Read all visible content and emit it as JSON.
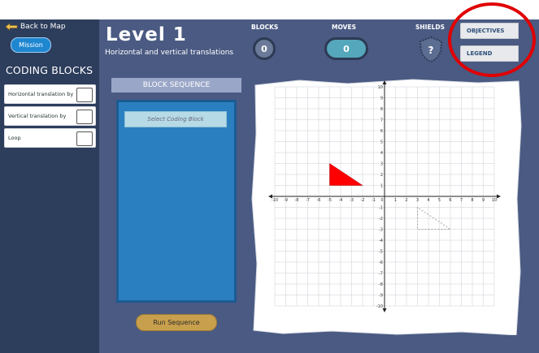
{
  "sidebar": {
    "back_label": "Back to Map",
    "mission_label": "Mission",
    "title": "CODING BLOCKS",
    "blocks": [
      {
        "label": "Horizontal translation by"
      },
      {
        "label": "Vertical translation by"
      },
      {
        "label": "Loop"
      }
    ]
  },
  "header": {
    "level": "Level 1",
    "subtitle": "Horizontal and vertical translations",
    "blocks_label": "BLOCKS",
    "blocks_value": "0",
    "moves_label": "MOVES",
    "moves_value": "0",
    "shields_label": "SHIELDS",
    "shields_value": "?"
  },
  "tabs": {
    "objectives": "OBJECTIVES",
    "legend": "LEGEND"
  },
  "sequence": {
    "header": "BLOCK SEQUENCE",
    "placeholder": "Select Coding Block",
    "run_label": "Run Sequence"
  },
  "grid": {
    "x_min": -10,
    "x_max": 10,
    "y_min": -10,
    "y_max": 10,
    "shape_fill": "#ff0000",
    "shape": [
      [
        -5,
        3
      ],
      [
        -5,
        1
      ],
      [
        -2,
        1
      ]
    ],
    "target": [
      [
        3,
        -1
      ],
      [
        3,
        -3
      ],
      [
        6,
        -3
      ]
    ]
  },
  "colors": {
    "bg": "#4a5a82",
    "sidebar": "#2d3d5c",
    "accent_red_circle": "#e00000"
  }
}
